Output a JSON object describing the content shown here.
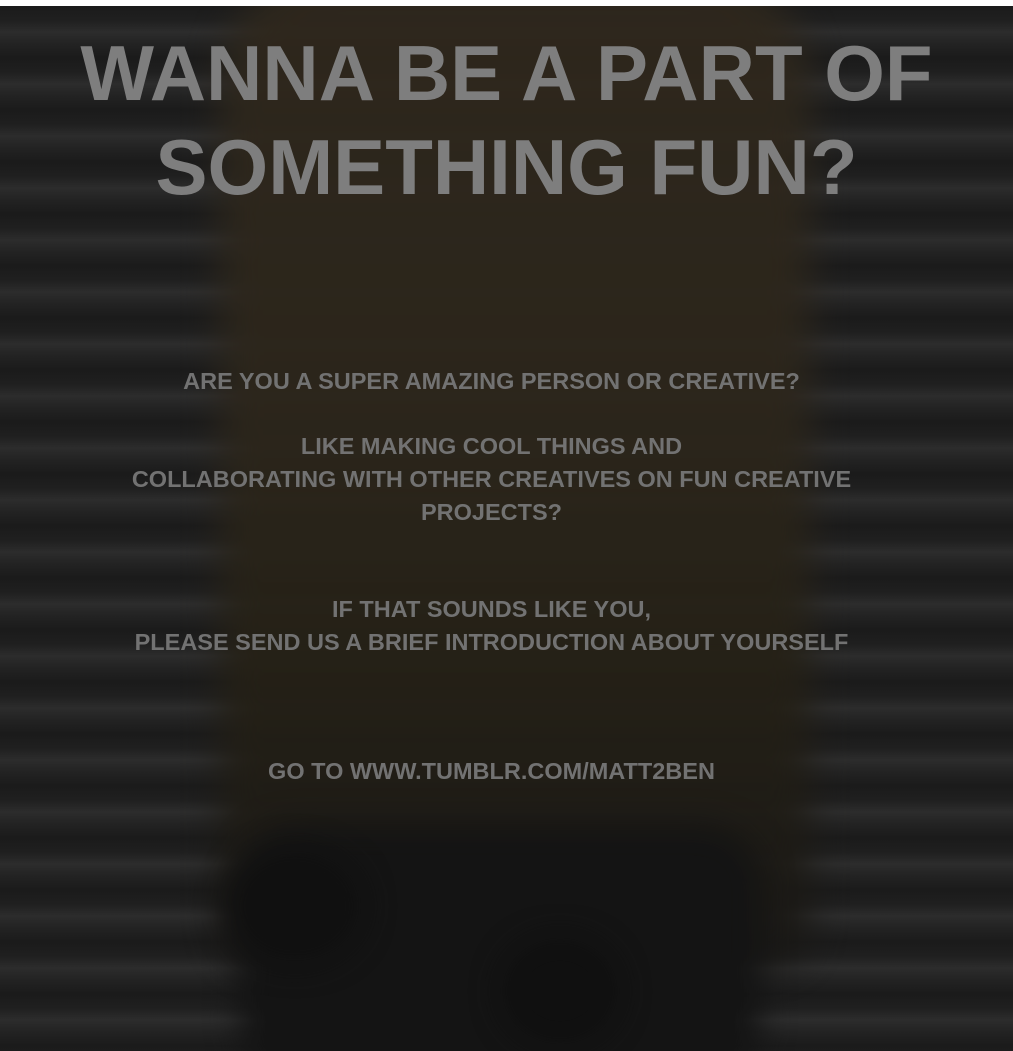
{
  "headline": {
    "line1": "WANNA BE A PART OF",
    "line2": "SOMETHING FUN?"
  },
  "question": "ARE YOU A SUPER AMAZING PERSON OR CREATIVE?",
  "collaboration": {
    "line1": "LIKE MAKING COOL THINGS AND",
    "line2": "COLLABORATING WITH OTHER CREATIVES ON FUN CREATIVE",
    "line3": "PROJECTS?"
  },
  "invitation": {
    "line1": "IF THAT SOUNDS LIKE YOU,",
    "line2": "PLEASE SEND US A BRIEF INTRODUCTION ABOUT YOURSELF"
  },
  "call_to_action": "GO TO WWW.TUMBLR.COM/MATT2BEN",
  "colors": {
    "background": "#262626",
    "headline_text": "#7e7e7e",
    "body_text": "#727272"
  }
}
